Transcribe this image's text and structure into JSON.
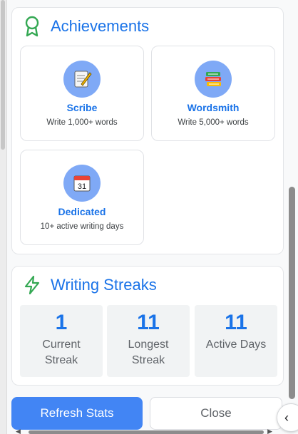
{
  "achievements": {
    "title": "Achievements",
    "icon": "ribbon-icon",
    "items": [
      {
        "name": "Scribe",
        "desc": "Write 1,000+ words",
        "icon": "memo-icon"
      },
      {
        "name": "Wordsmith",
        "desc": "Write 5,000+ words",
        "icon": "books-icon"
      },
      {
        "name": "Dedicated",
        "desc": "10+ active writing days",
        "icon": "calendar-icon",
        "icon_text": "31"
      }
    ]
  },
  "streaks": {
    "title": "Writing Streaks",
    "icon": "lightning-icon",
    "stats": [
      {
        "value": "1",
        "label": "Current Streak"
      },
      {
        "value": "11",
        "label": "Longest Streak"
      },
      {
        "value": "11",
        "label": "Active Days"
      }
    ]
  },
  "actions": {
    "refresh_label": "Refresh Stats",
    "close_label": "Close",
    "collapse_glyph": "‹"
  },
  "colors": {
    "accent": "#1a73e8",
    "button": "#4285f4",
    "ribbon": "#34a853"
  }
}
